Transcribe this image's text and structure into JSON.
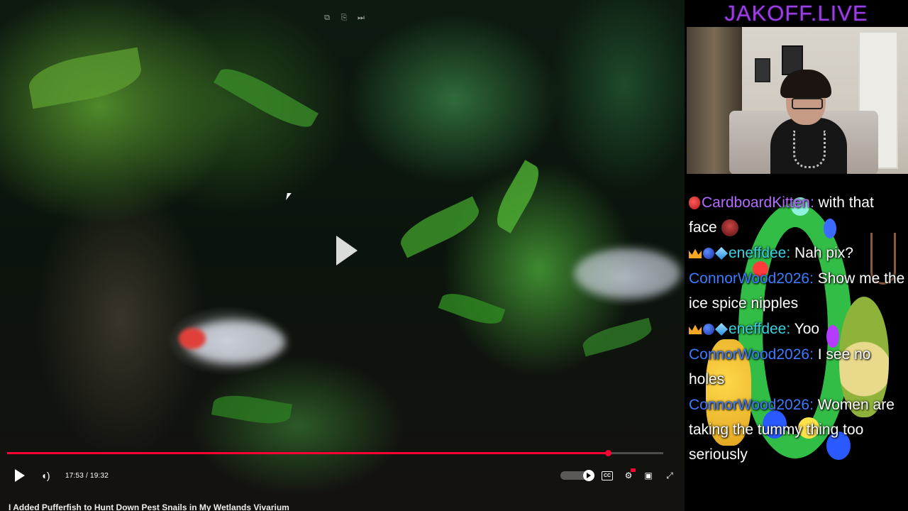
{
  "video": {
    "title": "I Added Pufferfish to Hunt Down Pest Snails in My Wetlands Vivarium",
    "time": "17:53 / 19:32",
    "progress": 0.916,
    "colors": {
      "progress": "#ff0033"
    },
    "top_icons": [
      "external-link-icon",
      "share-icon",
      "next-icon"
    ],
    "controls": [
      "play-icon",
      "volume-icon",
      "autoplay-toggle",
      "captions-icon",
      "settings-icon",
      "miniplayer-icon",
      "fullscreen-icon"
    ]
  },
  "sidebar": {
    "brand": "JAKOFF.LIVE",
    "brand_color": "#9a3fe0"
  },
  "chat": [
    {
      "badges": [
        "berry-badge"
      ],
      "user": "CardboardKitten",
      "user_color": "#b36bff",
      "text": "with that face",
      "emote": "demon-face-emote"
    },
    {
      "badges": [
        "crown-badge",
        "blue-orb-badge",
        "ice-cube-badge"
      ],
      "user": "eneffdee",
      "user_color": "#3ad1e0",
      "text": "Nah pix?"
    },
    {
      "badges": [],
      "user": "ConnorWood2026",
      "user_color": "#3c7bff",
      "text": "Show me the ice spice nipples"
    },
    {
      "badges": [
        "crown-badge",
        "blue-orb-badge",
        "ice-cube-badge"
      ],
      "user": "eneffdee",
      "user_color": "#3ad1e0",
      "text": "Yoo"
    },
    {
      "badges": [],
      "user": "ConnorWood2026",
      "user_color": "#3c7bff",
      "text": "I see no holes"
    },
    {
      "badges": [],
      "user": "ConnorWood2026",
      "user_color": "#3c7bff",
      "text": "Women are taking the tummy thing too seriously"
    }
  ]
}
